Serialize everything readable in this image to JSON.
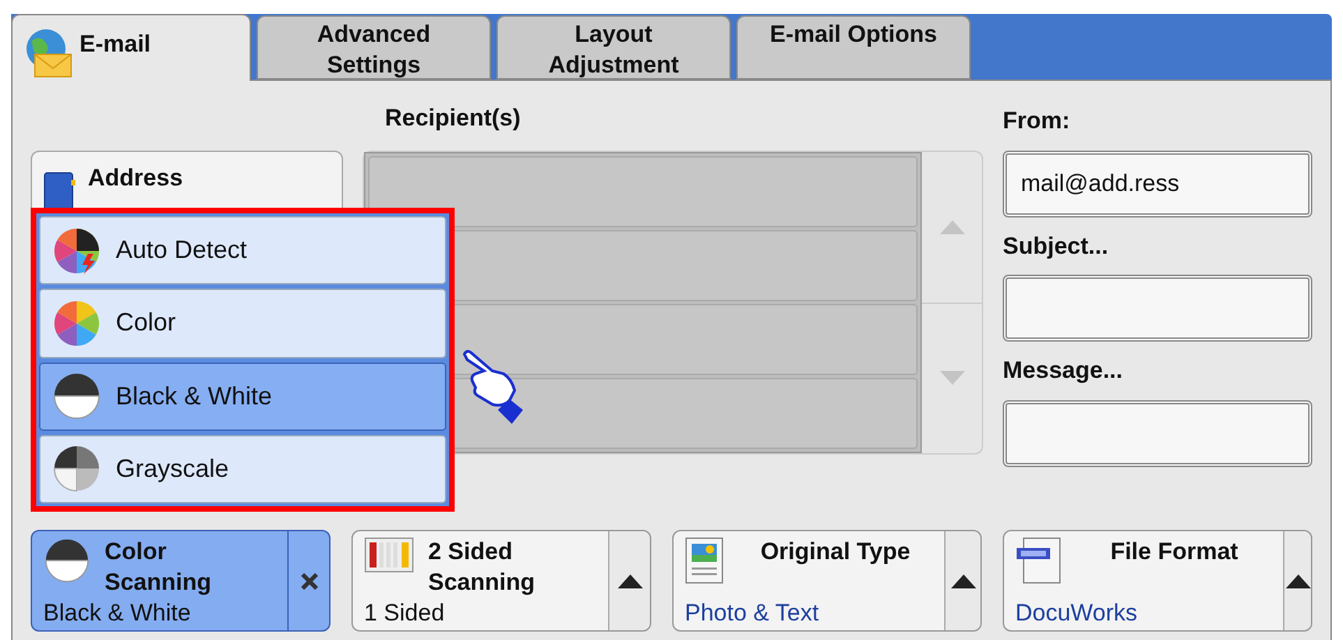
{
  "tabs": [
    {
      "label": "E-mail",
      "selected": true
    },
    {
      "label": "Advanced Settings",
      "selected": false
    },
    {
      "label": "Layout Adjustment",
      "selected": false
    },
    {
      "label": "E-mail Options",
      "selected": false
    }
  ],
  "address_book": {
    "label": "Address"
  },
  "recipients": {
    "label": "Recipient(s)"
  },
  "fields": [
    {
      "label": "From:",
      "value": "mail@add.ress"
    },
    {
      "label": "Subject..."
    },
    {
      "label": "Message..."
    }
  ],
  "color_menu": [
    {
      "kind": "auto",
      "label": "Auto Detect",
      "selected": false
    },
    {
      "kind": "color",
      "label": "Color",
      "selected": false
    },
    {
      "kind": "bw",
      "label": "Black & White",
      "selected": true
    },
    {
      "kind": "gray",
      "label": "Grayscale",
      "selected": false
    }
  ],
  "features": [
    {
      "kind": "color",
      "title": "Color Scanning",
      "value": "Black & White",
      "active": true,
      "color": "#111111"
    },
    {
      "kind": "sided",
      "title": "2 Sided Scanning",
      "value": "1 Sided",
      "active": false,
      "color": "#111111"
    },
    {
      "kind": "original",
      "title": "Original Type",
      "value": "Photo & Text",
      "active": false,
      "color": "#1c3f9e"
    },
    {
      "kind": "format",
      "title": "File Format",
      "value": "DocuWorks",
      "active": false,
      "color": "#1c3f9e"
    }
  ]
}
